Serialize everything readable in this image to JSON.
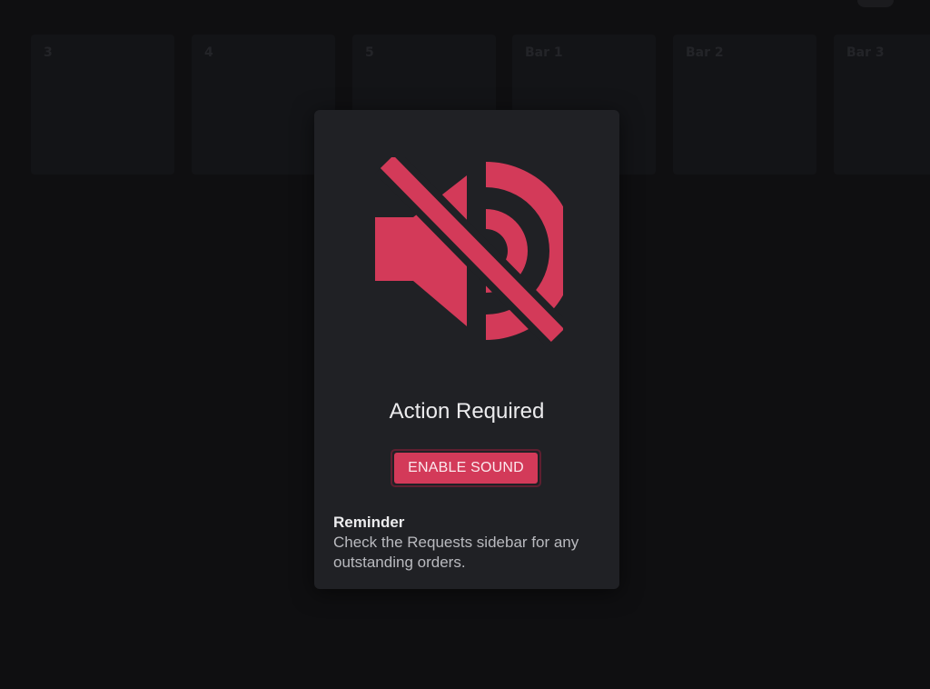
{
  "background": {
    "tiles": [
      {
        "label": "3"
      },
      {
        "label": "4"
      },
      {
        "label": "5"
      },
      {
        "label": "Bar 1"
      },
      {
        "label": "Bar 2"
      },
      {
        "label": "Bar 3"
      }
    ]
  },
  "dialog": {
    "icon": "volume-off-icon",
    "title": "Action Required",
    "enable_button_label": "ENABLE SOUND",
    "reminder_title": "Reminder",
    "reminder_body": "Check the Requests sidebar for any outstanding orders."
  },
  "colors": {
    "accent": "#d33a59",
    "dialog_bg": "#202125",
    "page_bg": "#141416"
  }
}
